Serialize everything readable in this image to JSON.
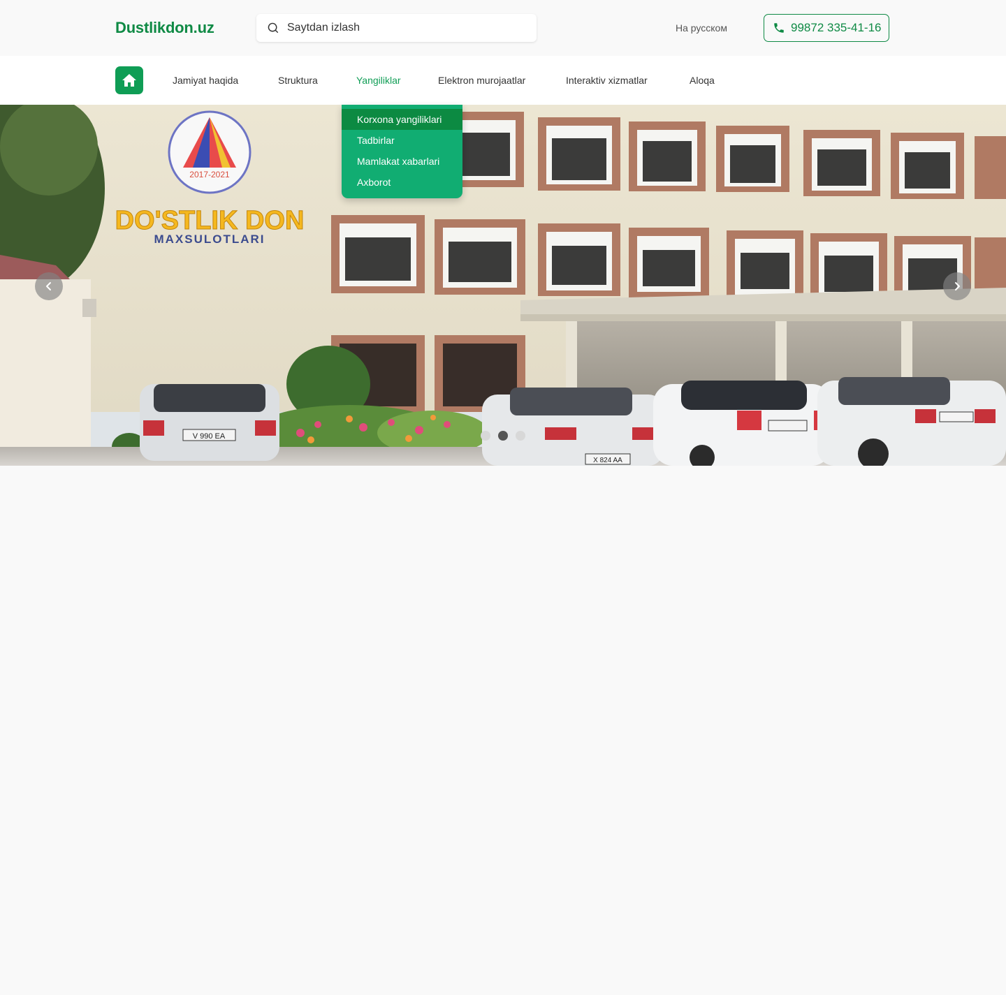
{
  "header": {
    "logo": "Dustlikdon.uz",
    "search_placeholder": "Saytdan izlash",
    "lang_switch": "На русском",
    "phone": "99872 335-41-16"
  },
  "nav": {
    "items": [
      {
        "label": "Jamiyat haqida"
      },
      {
        "label": "Struktura"
      },
      {
        "label": "Yangiliklar",
        "active": true
      },
      {
        "label": "Elektron murojaatlar"
      },
      {
        "label": "Interaktiv xizmatlar"
      },
      {
        "label": "Aloqa"
      }
    ]
  },
  "dropdown": {
    "items": [
      {
        "label": "Korxona yangiliklari",
        "active": true
      },
      {
        "label": "Tadbirlar"
      },
      {
        "label": "Mamlakat xabarlari"
      },
      {
        "label": "Axborot"
      }
    ]
  },
  "hero": {
    "sign_main": "DO'STLIK DON",
    "sign_sub": "MAXSULOTLARI",
    "emblem_years": "2017-2021",
    "plates": [
      "V 990 EA",
      "X 824 AA"
    ],
    "active_slide": 2,
    "slide_count": 3
  },
  "colors": {
    "brand": "#0f8a45",
    "brand_bright": "#0f9d55",
    "dropdown_bg": "#11ad72",
    "dropdown_active": "#0c8a42"
  },
  "icons": {
    "search": "search-icon",
    "phone": "phone-icon",
    "home": "home-icon",
    "prev": "chevron-left-icon",
    "next": "chevron-right-icon"
  }
}
